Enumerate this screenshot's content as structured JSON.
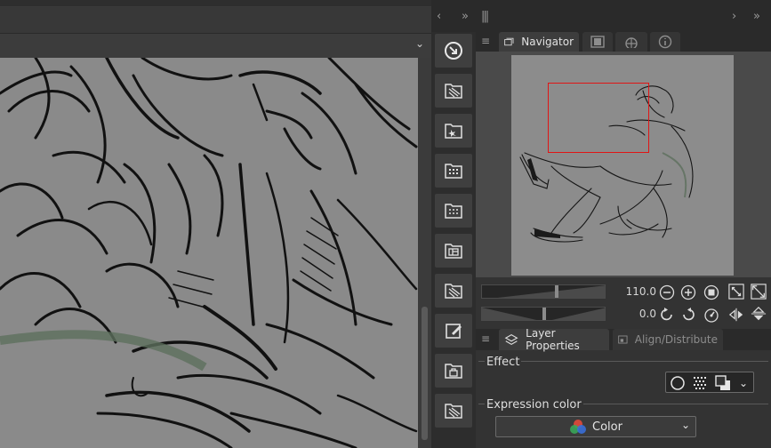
{
  "navigator": {
    "tab_label": "Navigator",
    "zoom_value": "110.0",
    "rotation_value": "0.0"
  },
  "layer_properties": {
    "tab_label": "Layer Properties",
    "align_tab_label": "Align/Distribute",
    "effect_label": "Effect",
    "expression_color_label": "Expression color",
    "expression_color_value": "Color"
  },
  "icons": {
    "dock_collapse": "chevron-left-icon",
    "dock_expand": "double-chevron-right-icon",
    "panel_menu": "hamburger-icon"
  },
  "colors": {
    "view_rect": "#e01515",
    "canvas_paper": "#8a8a8a",
    "guide_stroke": "#5c6f5c"
  }
}
